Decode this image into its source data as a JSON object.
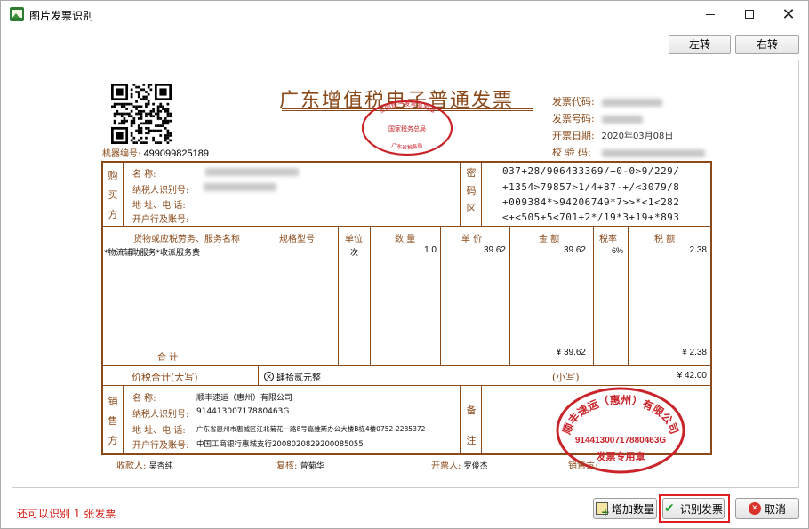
{
  "window": {
    "title": "图片发票识别",
    "minimize": "",
    "maximize": "",
    "close": "✕"
  },
  "toolbar": {
    "rotate_left": "左转",
    "rotate_right": "右转"
  },
  "invoice": {
    "title": "广东增值税电子普通发票",
    "machine_label": "机器编号:",
    "machine_no": "499099825189",
    "meta": {
      "code_label": "发票代码:",
      "number_label": "发票号码:",
      "date_label": "开票日期:",
      "date_value": "2020年03月08日",
      "check_label": "校 验 码:"
    },
    "seal_top": {
      "arc_text": "全国统一发票监制章",
      "middle_text": "国家税务总局",
      "bottom_text": "广东省税务局"
    },
    "buyer": {
      "section_label": [
        "购",
        "买",
        "方"
      ],
      "name_label": "名        称:",
      "tax_label": "纳税人识别号:",
      "addr_label": "地 址、电 话:",
      "bank_label": "开户行及账号:"
    },
    "cipher": {
      "section_label": [
        "密",
        "码",
        "区"
      ],
      "lines": [
        "037+28/906433369/+0-0>9/229/",
        "+1354>79857>1/4+87-+/<3079/8",
        "+009384*>94206749*7>>*<1<282",
        "<+<505+5<701+2*/19*3+19+*893"
      ]
    },
    "items": {
      "headers": {
        "name": "货物或应税劳务、服务名称",
        "spec": "规格型号",
        "unit": "单位",
        "qty": "数 量",
        "price": "单 价",
        "amount": "金 额",
        "rate": "税率",
        "tax": "税 额"
      },
      "rows": [
        {
          "name": "*物流辅助服务*收派服务费",
          "spec": "",
          "unit": "次",
          "qty": "1.0",
          "price": "39.62",
          "amount": "39.62",
          "rate": "6%",
          "tax": "2.38"
        }
      ],
      "total_label": "合          计",
      "total_amount": "¥ 39.62",
      "total_tax": "¥ 2.38"
    },
    "grand_total": {
      "label": "价税合计(大写)",
      "upper": "肆拾贰元整",
      "small_label": "(小写)",
      "small_value": "¥ 42.00"
    },
    "seller": {
      "section_label": [
        "销",
        "售",
        "方"
      ],
      "name_label": "名        称:",
      "name_value": "顺丰速运（惠州）有限公司",
      "tax_label": "纳税人识别号:",
      "tax_value": "91441300717880463G",
      "addr_label": "地 址、电 话:",
      "addr_value": "广东省惠州市惠城区江北菊花一路8号嘉维斯办公大楼B栋4楼0752-2285372",
      "bank_label": "开户行及账号:",
      "bank_value": "中国工商银行惠城支行2008020829200085055"
    },
    "remark_label": [
      "备",
      "注"
    ],
    "seal_big": {
      "arc_text": "顺丰速运（惠州）有限公司",
      "tax_no": "91441300717880463G",
      "bottom_text": "发票专用章"
    },
    "footer": {
      "payee_label": "收款人:",
      "payee": "吴杏纯",
      "reviewer_label": "复核:",
      "reviewer": "曾菊华",
      "drawer_label": "开票人:",
      "drawer": "罗俊杰",
      "seller_label": "销售方:"
    }
  },
  "status": {
    "message": "还可以识别 1 张发票"
  },
  "buttons": {
    "add_qty": "增加数量",
    "recognize": "识别发票",
    "cancel": "取消"
  },
  "colors": {
    "invoice_ink": "#8b4a1a",
    "seal_red": "#c8242a",
    "status_red": "#d3241c",
    "highlight": "#e02020"
  }
}
